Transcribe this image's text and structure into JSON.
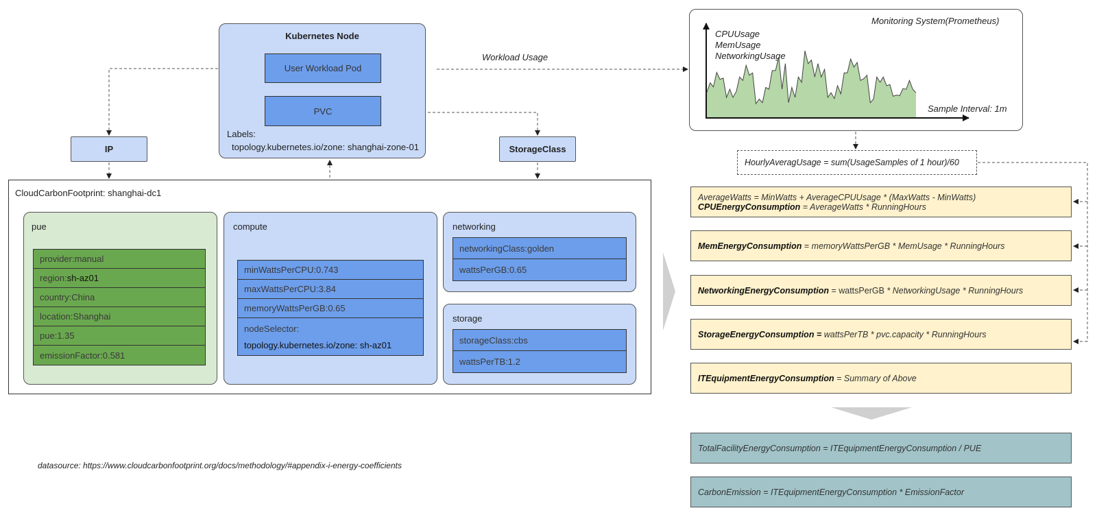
{
  "kubernetes_node": {
    "title": "Kubernetes Node",
    "pod_label": "User Workload Pod",
    "pvc_label": "PVC",
    "labels_title": "Labels:",
    "labels_value": "topology.kubernetes.io/zone: shanghai-zone-01"
  },
  "ip_box": {
    "label": "IP"
  },
  "storageclass_box": {
    "label": "StorageClass"
  },
  "edges": {
    "workload_usage": "Workload Usage"
  },
  "ccf": {
    "title": "CloudCarbonFootprint: shanghai-dc1",
    "pue": {
      "title": "pue",
      "rows": [
        {
          "key": "provider: ",
          "value": "manual"
        },
        {
          "key": "region: ",
          "value": "sh-az01"
        },
        {
          "key": "country: ",
          "value": "China"
        },
        {
          "key": "location: ",
          "value": "Shanghai"
        },
        {
          "key": "pue: ",
          "value": "1.35"
        },
        {
          "key": "emissionFactor: ",
          "value": "0.581"
        }
      ]
    },
    "compute": {
      "title": "compute",
      "rows": [
        {
          "key": "minWattsPerCPU: ",
          "value": "0.743"
        },
        {
          "key": "maxWattsPerCPU: ",
          "value": "3.84"
        },
        {
          "key": "memoryWattsPerGB: ",
          "value": "0.65"
        }
      ],
      "node_selector_key": "nodeSelector:",
      "node_selector_value": "topology.kubernetes.io/zone: sh-az01"
    },
    "networking": {
      "title": "networking",
      "rows": [
        {
          "key": "networkingClass: ",
          "value": "golden"
        },
        {
          "key": "wattsPerGB: ",
          "value": "0.65"
        }
      ]
    },
    "storage": {
      "title": "storage",
      "rows": [
        {
          "key": "storageClass: ",
          "value": "cbs"
        },
        {
          "key": "wattsPerTB: ",
          "value": "1.2"
        }
      ]
    }
  },
  "monitoring": {
    "title": "Monitoring System(Prometheus)",
    "series": [
      "CPUUsage",
      "MemUsage",
      "NetworkingUsage"
    ],
    "sample_interval": "Sample Interval: 1m",
    "sparkline": [
      0.29,
      0.45,
      0.38,
      0.63,
      0.51,
      0.53,
      0.2,
      0.34,
      0.2,
      0.3,
      0.55,
      0.49,
      0.75,
      0.58,
      0.62,
      0.09,
      0.17,
      0.11,
      0.37,
      0.34,
      0.66,
      0.66,
      0.89,
      0.34,
      0.78,
      0.11,
      0.37,
      0.2,
      0.55,
      0.46,
      1.0,
      0.78,
      0.84,
      0.55,
      0.78,
      0.55,
      0.68,
      0.2,
      0.28,
      0.18,
      0.4,
      0.26,
      0.62,
      0.62,
      0.86,
      0.72,
      0.8,
      0.49,
      0.52,
      0.58,
      0.11,
      0.17,
      0.55,
      0.46,
      0.55,
      0.4,
      0.42,
      0.22,
      0.24,
      0.23,
      0.35,
      0.34,
      0.49,
      0.34,
      0.28
    ]
  },
  "hourly": {
    "formula": "HourlyAveragUsage = sum(UsageSamples of 1 hour)/60"
  },
  "formulas": {
    "cpu_line1": "AverageWatts = MinWatts + AverageCPUUsage * (MaxWatts - MinWatts)",
    "cpu_name": "CPUEnergyConsumption",
    "cpu_expr": " = AverageWatts * RunningHours",
    "mem_name": "MemEnergyConsumption",
    "mem_eq": " = ",
    "mem_expr": "memoryWattsPerGB * MemUsage * RunningHours",
    "net_name": "NetworkingEnergyConsumption",
    "net_plain": " = wattsPerGB ",
    "net_expr": " * NetworkingUsage * RunningHours",
    "sto_name": "StorageEnergyConsumption",
    "sto_eq": " = ",
    "sto_expr": "wattsPerTB * pvc.capacity * RunningHours",
    "it_name": "ITEquipmentEnergyConsumption",
    "it_expr": " = Summary of Above",
    "total_facility": "TotalFacilityEnergyConsumption = ITEquipmentEnergyConsumption / PUE",
    "carbon_emission": "CarbonEmission = ITEquipmentEnergyConsumption * EmissionFactor"
  },
  "footer": {
    "datasource": "datasource: https://www.cloudcarbonfootprint.org/docs/methodology/#appendix-i-energy-coefficients"
  }
}
